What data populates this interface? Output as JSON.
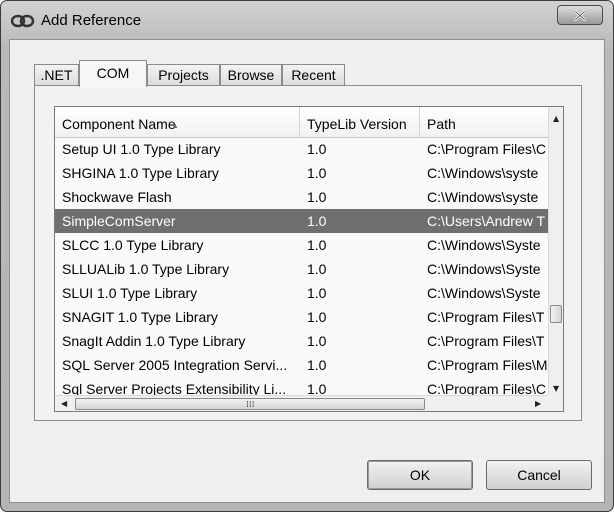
{
  "window": {
    "title": "Add Reference",
    "close_icon": "close-icon"
  },
  "tabs": [
    {
      "label": ".NET",
      "active": false
    },
    {
      "label": "COM",
      "active": true
    },
    {
      "label": "Projects",
      "active": false
    },
    {
      "label": "Browse",
      "active": false
    },
    {
      "label": "Recent",
      "active": false
    }
  ],
  "list": {
    "columns": [
      "Component Name",
      "TypeLib Version",
      "Path"
    ],
    "sorted_column": "Component Name",
    "rows": [
      {
        "name": "Setup UI 1.0 Type Library",
        "version": "1.0",
        "path": "C:\\Program Files\\C"
      },
      {
        "name": "SHGINA 1.0 Type Library",
        "version": "1.0",
        "path": "C:\\Windows\\syste"
      },
      {
        "name": "Shockwave Flash",
        "version": "1.0",
        "path": "C:\\Windows\\syste"
      },
      {
        "name": "SimpleComServer",
        "version": "1.0",
        "path": "C:\\Users\\Andrew T",
        "selected": true
      },
      {
        "name": "SLCC 1.0 Type Library",
        "version": "1.0",
        "path": "C:\\Windows\\Syste"
      },
      {
        "name": "SLLUALib 1.0 Type Library",
        "version": "1.0",
        "path": "C:\\Windows\\Syste"
      },
      {
        "name": "SLUI 1.0 Type Library",
        "version": "1.0",
        "path": "C:\\Windows\\Syste"
      },
      {
        "name": "SNAGIT 1.0 Type Library",
        "version": "1.0",
        "path": "C:\\Program Files\\T"
      },
      {
        "name": "SnagIt Addin 1.0 Type Library",
        "version": "1.0",
        "path": "C:\\Program Files\\T"
      },
      {
        "name": "SQL Server 2005 Integration Servi...",
        "version": "1.0",
        "path": "C:\\Program Files\\M"
      },
      {
        "name": "Sql Server Projects Extensibility Li...",
        "version": "1.0",
        "path": "C:\\Program Files\\C"
      }
    ]
  },
  "buttons": {
    "ok": "OK",
    "cancel": "Cancel"
  },
  "colors": {
    "selected_row": "#6f6f6f",
    "window_chrome": "#b9b9b9"
  }
}
